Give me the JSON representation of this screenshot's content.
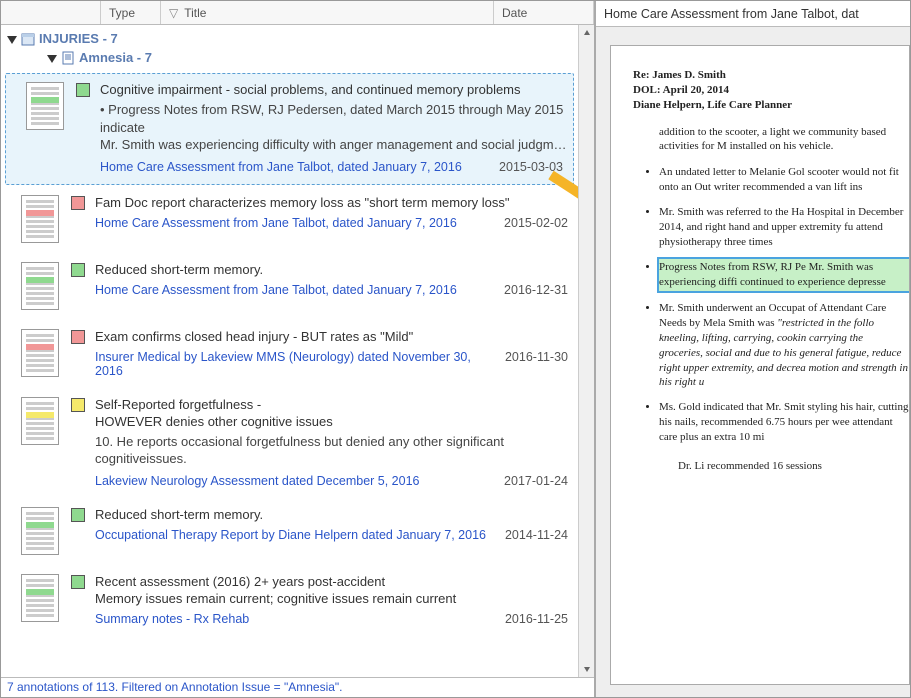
{
  "columns": {
    "blank": "",
    "type": "Type",
    "title": "Title",
    "date": "Date"
  },
  "tree": {
    "top": {
      "label": "INJURIES - 7"
    },
    "child": {
      "label": "Amnesia - 7"
    }
  },
  "items": [
    {
      "tag": "green",
      "title": "Cognitive impairment - social problems, and continued memory problems",
      "snippet_l1": "• Progress Notes from RSW, RJ Pedersen, dated March 2015 through May 2015 indicate",
      "snippet_l2": "Mr. Smith was experiencing difficulty with anger management and social judgm…",
      "source": "Home Care Assessment from Jane Talbot, dated January 7, 2016",
      "date": "2015-03-03",
      "selected": true,
      "thumb_hl": "green"
    },
    {
      "tag": "red",
      "title": "Fam Doc report characterizes memory loss as \"short term memory loss\"",
      "snippet_l1": "",
      "snippet_l2": "",
      "source": "Home Care Assessment from Jane Talbot, dated January 7, 2016",
      "date": "2015-02-02",
      "thumb_hl": "red"
    },
    {
      "tag": "green",
      "title": "Reduced short-term memory.",
      "snippet_l1": "",
      "snippet_l2": "",
      "source": "Home Care Assessment from Jane Talbot, dated January 7, 2016",
      "date": "2016-12-31",
      "thumb_hl": "green"
    },
    {
      "tag": "red",
      "title": "Exam confirms closed head injury - BUT rates as \"Mild\"",
      "snippet_l1": "",
      "snippet_l2": "",
      "source": "Insurer Medical by Lakeview MMS (Neurology) dated November 30, 2016",
      "date": "2016-11-30",
      "thumb_hl": "red"
    },
    {
      "tag": "yellow",
      "title": "Self-Reported forgetfulness -",
      "title2": "HOWEVER denies other cognitive issues",
      "snippet_l1": "10.  He reports occasional forgetfulness but denied any other significant cognitiveissues.",
      "snippet_l2": "",
      "source": "Lakeview Neurology Assessment dated December 5, 2016",
      "date": "2017-01-24",
      "thumb_hl": "yellow"
    },
    {
      "tag": "green",
      "title": "Reduced short-term memory.",
      "snippet_l1": "",
      "snippet_l2": "",
      "source": "Occupational Therapy Report by Diane Helpern dated January 7, 2016",
      "date": "2014-11-24",
      "thumb_hl": "green"
    },
    {
      "tag": "green",
      "title": "Recent assessment (2016) 2+ years post-accident",
      "title2": "Memory issues remain current; cognitive issues remain current",
      "snippet_l1": "",
      "snippet_l2": "",
      "source": "Summary notes - Rx Rehab",
      "date": "2016-11-25",
      "thumb_hl": "green"
    }
  ],
  "status": "7 annotations of 113.  Filtered on Annotation Issue = \"Amnesia\".",
  "breadcrumb": "Home Care Assessment from Jane Talbot, dat",
  "doc": {
    "re": "Re:  James D. Smith",
    "dol": "DOL: April 20, 2014",
    "from": "Diane Helpern, Life Care Planner",
    "p0": "addition to the scooter, a light we community based activities for M installed on his vehicle.",
    "b1": "An undated letter to Melanie Gol scooter would not fit onto an Out writer recommended a van lift ins",
    "b2": "Mr. Smith was referred to the Ha Hospital in December 2014, and right hand and upper extremity fu attend physiotherapy three times",
    "b3": "Progress Notes from RSW, RJ Pe Mr. Smith was experiencing diffi continued to experience depresse",
    "b4a": "Mr. Smith underwent an Occupat of Attendant Care Needs by Mela Smith was ",
    "b4b": "\"restricted in the follo kneeling, lifting, carrying, cookin carrying the groceries, social and due to his general fatigue, reduce right upper extremity, and decrea motion and strength in his right u",
    "b5": "Ms. Gold indicated that Mr. Smit styling his hair, cutting his nails, recommended 6.75 hours per wee attendant care plus an extra 10 mi",
    "tail": "Dr. Li recommended 16 sessions"
  }
}
